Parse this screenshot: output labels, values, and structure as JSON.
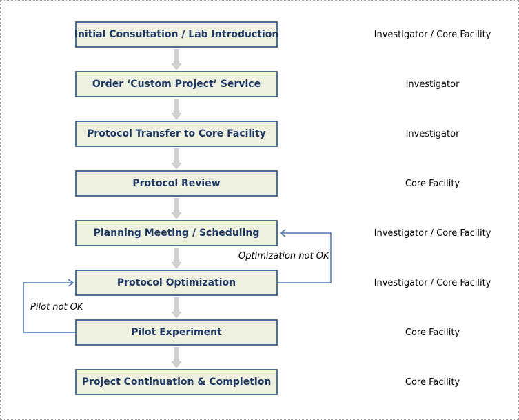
{
  "steps": [
    {
      "label": "Initial Consultation / Lab Introduction",
      "role": "Investigator / Core Facility"
    },
    {
      "label": "Order ‘Custom Project’ Service",
      "role": "Investigator"
    },
    {
      "label": "Protocol Transfer to Core Facility",
      "role": "Investigator"
    },
    {
      "label": "Protocol Review",
      "role": "Core Facility"
    },
    {
      "label": "Planning Meeting / Scheduling",
      "role": "Investigator / Core Facility"
    },
    {
      "label": "Protocol Optimization",
      "role": "Investigator / Core Facility"
    },
    {
      "label": "Pilot Experiment",
      "role": "Core Facility"
    },
    {
      "label": "Project Continuation & Completion",
      "role": "Core Facility"
    }
  ],
  "loops": {
    "optimization": {
      "label": "Optimization not OK",
      "from": "Protocol Optimization",
      "to": "Planning Meeting / Scheduling"
    },
    "pilot": {
      "label": "Pilot not OK",
      "from": "Pilot Experiment",
      "to": "Protocol Optimization"
    }
  },
  "colors": {
    "box_fill": "#eef0e0",
    "box_border": "#4f6f95",
    "box_text": "#1f3864",
    "flow_arrow": "#d0d0d0",
    "loop_line": "#4a74b0"
  }
}
